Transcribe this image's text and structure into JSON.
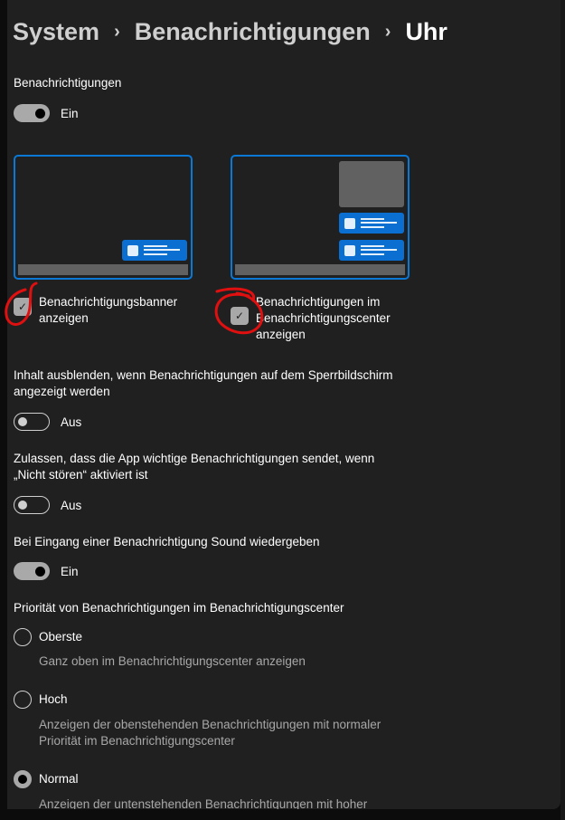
{
  "breadcrumb": {
    "items": [
      "System",
      "Benachrichtigungen",
      "Uhr"
    ]
  },
  "notifications": {
    "label": "Benachrichtigungen",
    "state": "Ein",
    "on": true
  },
  "banner": {
    "label_line1": "Benachrichtigungsbanner",
    "label_line2": "anzeigen",
    "checked": true
  },
  "center": {
    "label_line1": "Benachrichtigungen im",
    "label_line2": "Benachrichtigungscenter",
    "label_line3": "anzeigen",
    "checked": true
  },
  "hide_content": {
    "label_line1": "Inhalt ausblenden, wenn Benachrichtigungen auf dem Sperrbildschirm",
    "label_line2": "angezeigt werden",
    "state": "Aus",
    "on": false
  },
  "dnd": {
    "label_line1": "Zulassen, dass die App wichtige Benachrichtigungen sendet, wenn",
    "label_line2": "„Nicht stören“ aktiviert ist",
    "state": "Aus",
    "on": false
  },
  "sound": {
    "label": "Bei Eingang einer Benachrichtigung Sound wiedergeben",
    "state": "Ein",
    "on": true
  },
  "priority": {
    "label": "Priorität von Benachrichtigungen im Benachrichtigungscenter",
    "options": [
      {
        "label": "Oberste",
        "desc1": "Ganz oben im Benachrichtigungscenter anzeigen",
        "selected": false
      },
      {
        "label": "Hoch",
        "desc1": "Anzeigen der obenstehenden Benachrichtigungen mit normaler",
        "desc2": "Priorität im Benachrichtigungscenter",
        "selected": false
      },
      {
        "label": "Normal",
        "desc1": "Anzeigen der untenstehenden Benachrichtigungen mit hoher",
        "selected": true
      }
    ]
  },
  "colors": {
    "accent": "#0a78d4",
    "background": "#202020",
    "annotation": "#e01010"
  }
}
